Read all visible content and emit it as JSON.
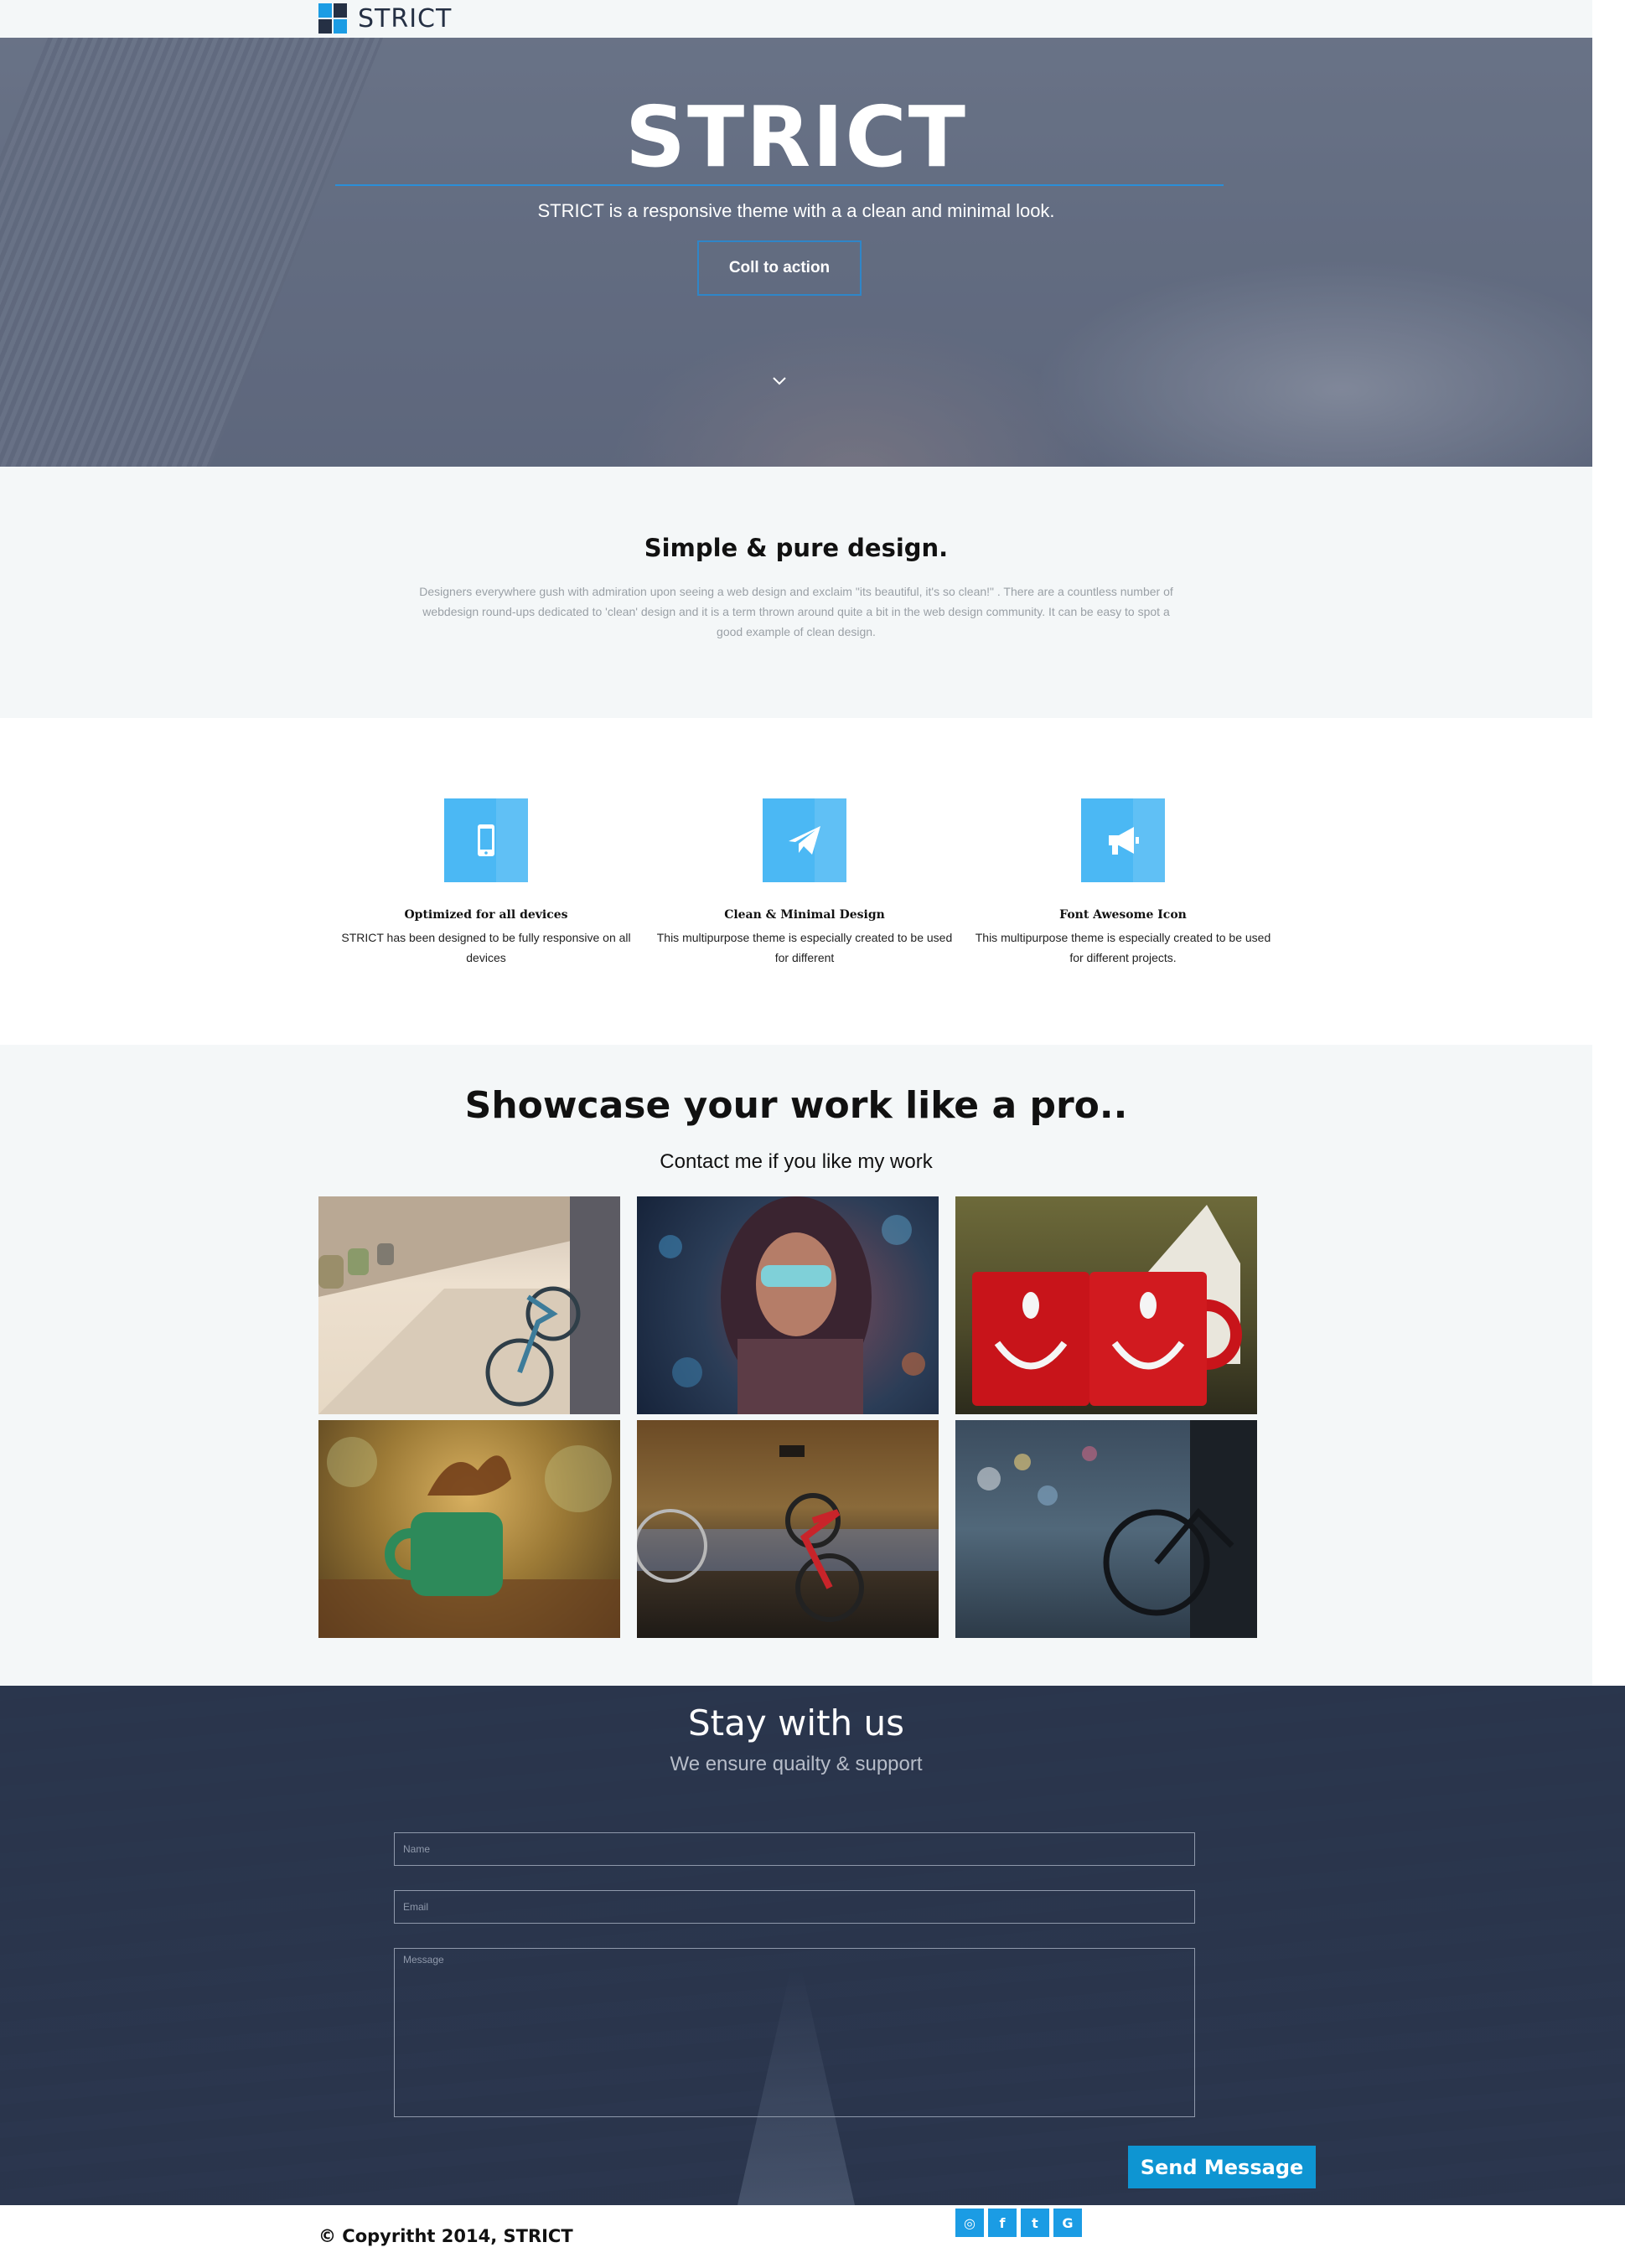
{
  "nav": {
    "brand": "STRICT"
  },
  "hero": {
    "title": "STRICT",
    "subtitle": "STRICT is a responsive theme with a a clean and minimal look.",
    "cta_label": "Coll to action"
  },
  "intro": {
    "heading": "Simple & pure design.",
    "body": "Designers everywhere gush with admiration upon seeing a web design and exclaim \"its beautiful, it's so clean!\" . There are a countless number of webdesign round-ups dedicated to 'clean' design and it is a term thrown around quite a bit in the web design community. It can be easy to spot a good example of clean design."
  },
  "features": [
    {
      "icon": "mobile-phone-icon",
      "title": "Optimized for all devices",
      "text": "STRICT has been designed to be fully responsive on all devices"
    },
    {
      "icon": "paper-plane-icon",
      "title": "Clean & Minimal Design",
      "text": "This multipurpose theme is especially created to be used for different"
    },
    {
      "icon": "bullhorn-icon",
      "title": "Font Awesome Icon",
      "text": "This multipurpose theme is especially created to be used for different projects."
    }
  ],
  "showcase": {
    "heading": "Showcase your work like a pro..",
    "lead": "Contact me if you like my work",
    "tiles": [
      "bicycle-street-photo",
      "woman-sunglasses-photo",
      "red-smiley-mugs-photo",
      "coffee-splash-photo",
      "red-bicycle-wall-photo",
      "bicycle-bokeh-photo"
    ]
  },
  "contact": {
    "heading": "Stay with us",
    "subheading": "We ensure quailty & support",
    "name_placeholder": "Name",
    "email_placeholder": "Email",
    "message_placeholder": "Message",
    "send_label": "Send Message"
  },
  "footer": {
    "copyright": "© Copyritht 2014, STRICT",
    "socials": [
      {
        "icon": "instagram-icon",
        "glyph": "◎"
      },
      {
        "icon": "facebook-icon",
        "glyph": "f"
      },
      {
        "icon": "twitter-icon",
        "glyph": "t"
      },
      {
        "icon": "google-plus-icon",
        "glyph": "G"
      }
    ]
  },
  "colors": {
    "accent": "#1b9ce4",
    "dark": "#253044",
    "feature_icon_bg": "#4bb8f4",
    "send_button": "#0e95d2"
  }
}
